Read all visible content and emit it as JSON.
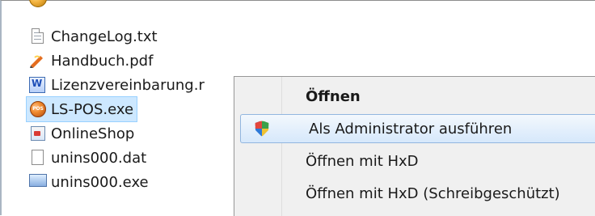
{
  "file_list": {
    "items": [
      {
        "name": "ChangeLog.txt",
        "icon": "text-file-icon"
      },
      {
        "name": "Handbuch.pdf",
        "icon": "pdf-file-icon"
      },
      {
        "name": "Lizenzvereinbarung.r",
        "icon": "word-document-icon"
      },
      {
        "name": "LS-POS.exe",
        "icon": "pos-app-icon"
      },
      {
        "name": "OnlineShop",
        "icon": "shortcut-icon"
      },
      {
        "name": "unins000.dat",
        "icon": "generic-file-icon"
      },
      {
        "name": "unins000.exe",
        "icon": "installer-icon"
      }
    ]
  },
  "context_menu": {
    "items": [
      {
        "label": "Öffnen",
        "icon": "",
        "bold": true
      },
      {
        "label": "Als Administrator ausführen",
        "icon": "uac-shield-icon",
        "highlighted": true
      },
      {
        "label": "Öffnen mit HxD",
        "icon": ""
      },
      {
        "label": "Öffnen mit HxD (Schreibgeschützt)",
        "icon": ""
      }
    ]
  },
  "colors": {
    "selection_background": "#cde8ff",
    "menu_background": "#f0f0f0",
    "highlight_background": "#d6e8fb"
  }
}
